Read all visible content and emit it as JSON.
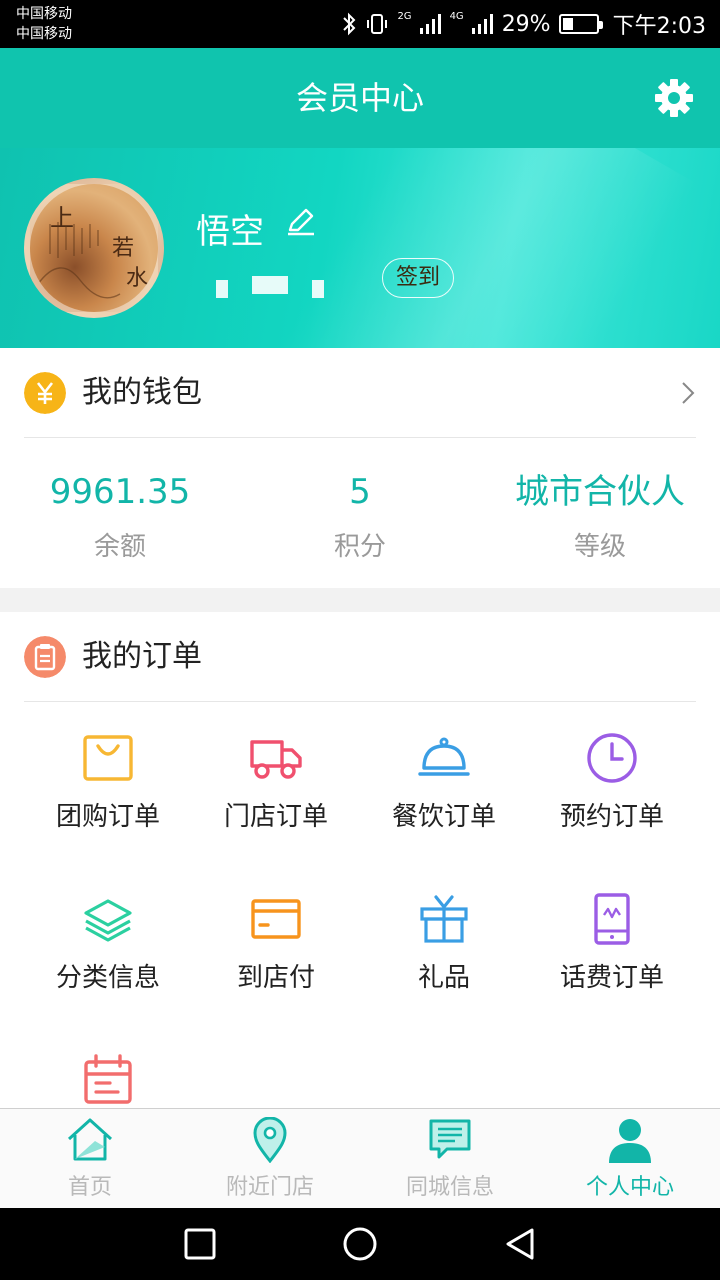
{
  "status_bar": {
    "carrier_1": "中国移动",
    "carrier_2": "中国移动",
    "network_1": "2G",
    "network_2": "4G",
    "battery": "29%",
    "battery_level": 0.29,
    "time": "下午2:03"
  },
  "header": {
    "title": "会员中心",
    "settings_icon": "gear-icon"
  },
  "profile": {
    "username": "悟空",
    "edit_icon": "pencil-icon",
    "checkin_label": "签到",
    "avatar_chars": [
      "上",
      "若",
      "水"
    ]
  },
  "wallet": {
    "title": "我的钱包",
    "icon": "yen-icon",
    "stats": [
      {
        "value": "9961.35",
        "label": "余额"
      },
      {
        "value": "5",
        "label": "积分"
      },
      {
        "value": "城市合伙人",
        "label": "等级"
      }
    ]
  },
  "orders": {
    "title": "我的订单",
    "icon": "clipboard-icon",
    "items": [
      {
        "label": "团购订单",
        "icon": "shopping-bag-icon",
        "color": "#f7b733"
      },
      {
        "label": "门店订单",
        "icon": "truck-icon",
        "color": "#f0506e"
      },
      {
        "label": "餐饮订单",
        "icon": "food-cloche-icon",
        "color": "#3a9ee4"
      },
      {
        "label": "预约订单",
        "icon": "clock-icon",
        "color": "#9b5de5"
      },
      {
        "label": "分类信息",
        "icon": "layers-icon",
        "color": "#2bd0a0"
      },
      {
        "label": "到店付",
        "icon": "card-icon",
        "color": "#f7941d"
      },
      {
        "label": "礼品",
        "icon": "gift-icon",
        "color": "#3a9ee4"
      },
      {
        "label": "话费订单",
        "icon": "phone-icon",
        "color": "#9b5de5"
      },
      {
        "label": "",
        "icon": "calendar-icon",
        "color": "#f26d6d"
      }
    ]
  },
  "bottom_nav": [
    {
      "label": "首页",
      "icon": "home-icon",
      "active": false
    },
    {
      "label": "附近门店",
      "icon": "location-pin-icon",
      "active": false
    },
    {
      "label": "同城信息",
      "icon": "message-icon",
      "active": false
    },
    {
      "label": "个人中心",
      "icon": "person-icon",
      "active": true
    }
  ],
  "colors": {
    "accent": "#12b5a8",
    "header": "#10c4ae",
    "inactive": "#b9b9b9"
  }
}
